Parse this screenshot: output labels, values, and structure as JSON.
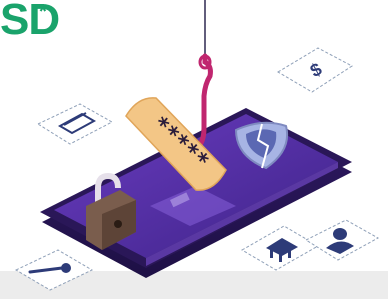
{
  "logo": {
    "text": "SD",
    "superscript": "*"
  },
  "colors": {
    "brand_green": "#1aa36b",
    "phone_body": "#3b2372",
    "phone_screen": "#5a33a6",
    "hook": "#c0266f",
    "bandage": "#f3c686",
    "shield": "#9aa6d6",
    "lock": "#8a6a55",
    "band": "#ececec"
  },
  "bandage_text": "*****",
  "icons": [
    "hook-icon",
    "password-bandage-icon",
    "broken-shield-icon",
    "padlock-icon",
    "credit-card-icon",
    "dollar-icon",
    "bank-icon",
    "user-icon",
    "key-icon"
  ]
}
